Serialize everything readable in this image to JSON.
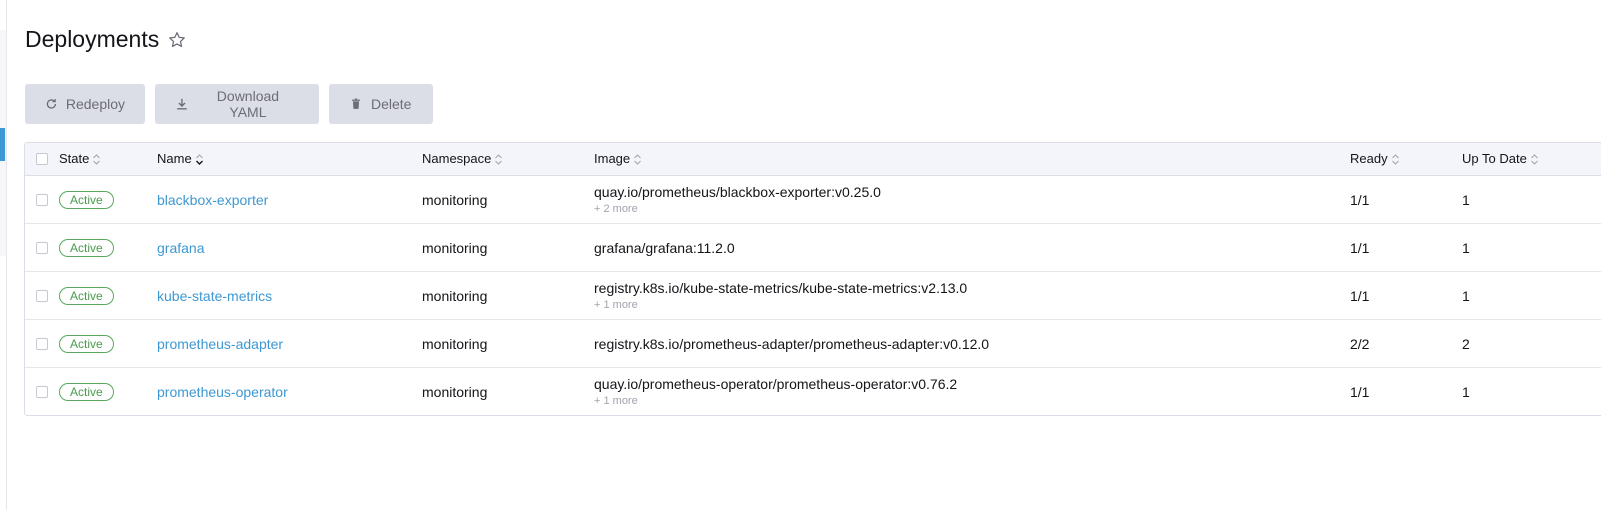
{
  "page": {
    "title": "Deployments"
  },
  "toolbar": {
    "redeploy_label": "Redeploy",
    "download_label": "Download YAML",
    "delete_label": "Delete"
  },
  "table": {
    "columns": [
      "State",
      "Name",
      "Namespace",
      "Image",
      "Ready",
      "Up To Date"
    ],
    "rows": [
      {
        "state": "Active",
        "name": "blackbox-exporter",
        "namespace": "monitoring",
        "image": "quay.io/prometheus/blackbox-exporter:v0.25.0",
        "more": "+ 2 more",
        "ready": "1/1",
        "up_to_date": "1"
      },
      {
        "state": "Active",
        "name": "grafana",
        "namespace": "monitoring",
        "image": "grafana/grafana:11.2.0",
        "more": "",
        "ready": "1/1",
        "up_to_date": "1"
      },
      {
        "state": "Active",
        "name": "kube-state-metrics",
        "namespace": "monitoring",
        "image": "registry.k8s.io/kube-state-metrics/kube-state-metrics:v2.13.0",
        "more": "+ 1 more",
        "ready": "1/1",
        "up_to_date": "1"
      },
      {
        "state": "Active",
        "name": "prometheus-adapter",
        "namespace": "monitoring",
        "image": "registry.k8s.io/prometheus-adapter/prometheus-adapter:v0.12.0",
        "more": "",
        "ready": "2/2",
        "up_to_date": "2"
      },
      {
        "state": "Active",
        "name": "prometheus-operator",
        "namespace": "monitoring",
        "image": "quay.io/prometheus-operator/prometheus-operator:v0.76.2",
        "more": "+ 1 more",
        "ready": "1/1",
        "up_to_date": "1"
      }
    ]
  },
  "colors": {
    "accent": "#3d98d3",
    "active_green": "#4a9a4e",
    "button_bg": "#dcdee7"
  }
}
